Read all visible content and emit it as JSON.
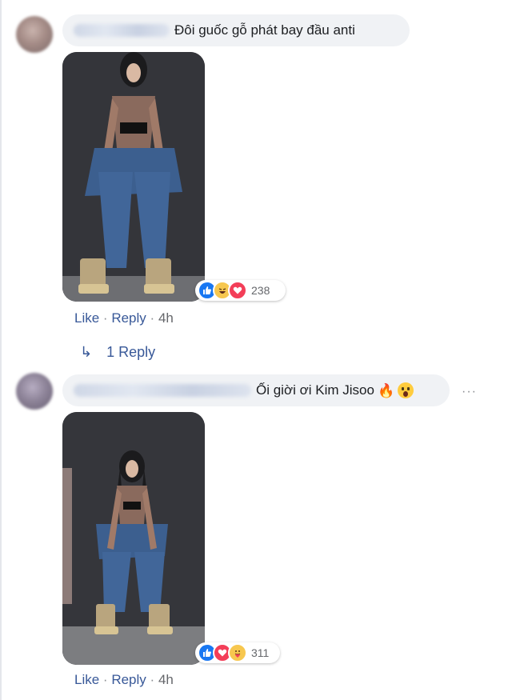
{
  "comments": [
    {
      "text": "Đôi guốc gỗ phát bay đầu anti",
      "reaction_count": "238",
      "reactions": [
        "like",
        "haha",
        "love"
      ],
      "actions": {
        "like": "Like",
        "reply": "Reply",
        "time": "4h"
      },
      "separator": "·",
      "replies_label": "1 Reply"
    },
    {
      "text": "Ối giời ơi Kim Jisoo",
      "emojis": [
        "fire",
        "scream"
      ],
      "reaction_count": "311",
      "reactions": [
        "like",
        "love",
        "care"
      ],
      "actions": {
        "like": "Like",
        "reply": "Reply",
        "time": "4h"
      },
      "separator": "·"
    }
  ],
  "more_menu": "···",
  "colors": {
    "link": "#385898",
    "meta": "#65676b",
    "bubble": "#f0f2f5",
    "like_blue": "#1877f2",
    "love_red": "#f33e58"
  }
}
